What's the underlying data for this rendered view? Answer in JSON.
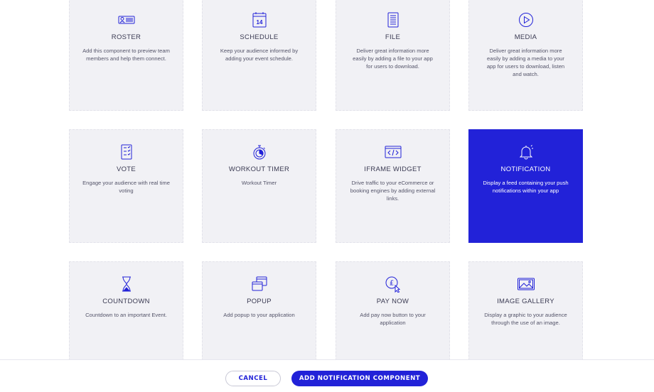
{
  "colors": {
    "accent": "#2222d8",
    "card_bg": "#f1f1f5"
  },
  "cards": [
    {
      "title": "ROSTER",
      "desc": "Add this component to preview team members and help them connect.",
      "icon": "roster-icon"
    },
    {
      "title": "SCHEDULE",
      "desc": "Keep your audience informed by adding your event schedule.",
      "icon": "calendar-icon",
      "icon_text": "14"
    },
    {
      "title": "FILE",
      "desc": "Deliver great information more easily by adding a file to your app for users to download.",
      "icon": "document-icon"
    },
    {
      "title": "MEDIA",
      "desc": "Deliver great information more easily by adding a media to your app for users to download, listen and watch.",
      "icon": "play-icon"
    },
    {
      "title": "VOTE",
      "desc": "Engage your audience with real time voting",
      "icon": "checklist-icon"
    },
    {
      "title": "WORKOUT TIMER",
      "desc": "Workout Timer",
      "icon": "stopwatch-icon"
    },
    {
      "title": "IFRAME WIDGET",
      "desc": "Drive traffic to your eCommerce or booking engines by adding external links.",
      "icon": "code-window-icon"
    },
    {
      "title": "NOTIFICATION",
      "desc": "Display a feed containing your push notifications within your app",
      "icon": "bell-icon",
      "selected": true
    },
    {
      "title": "COUNTDOWN",
      "desc": "Countdown to an important Event.",
      "icon": "hourglass-icon"
    },
    {
      "title": "POPUP",
      "desc": "Add popup to your application",
      "icon": "popup-windows-icon"
    },
    {
      "title": "PAY NOW",
      "desc": "Add pay now button to your application",
      "icon": "pound-click-icon",
      "icon_text": "£"
    },
    {
      "title": "IMAGE GALLERY",
      "desc": "Display a graphic to your audience through the use of an image.",
      "icon": "image-icon"
    }
  ],
  "footer": {
    "cancel_label": "CANCEL",
    "add_label": "ADD NOTIFICATION COMPONENT"
  }
}
